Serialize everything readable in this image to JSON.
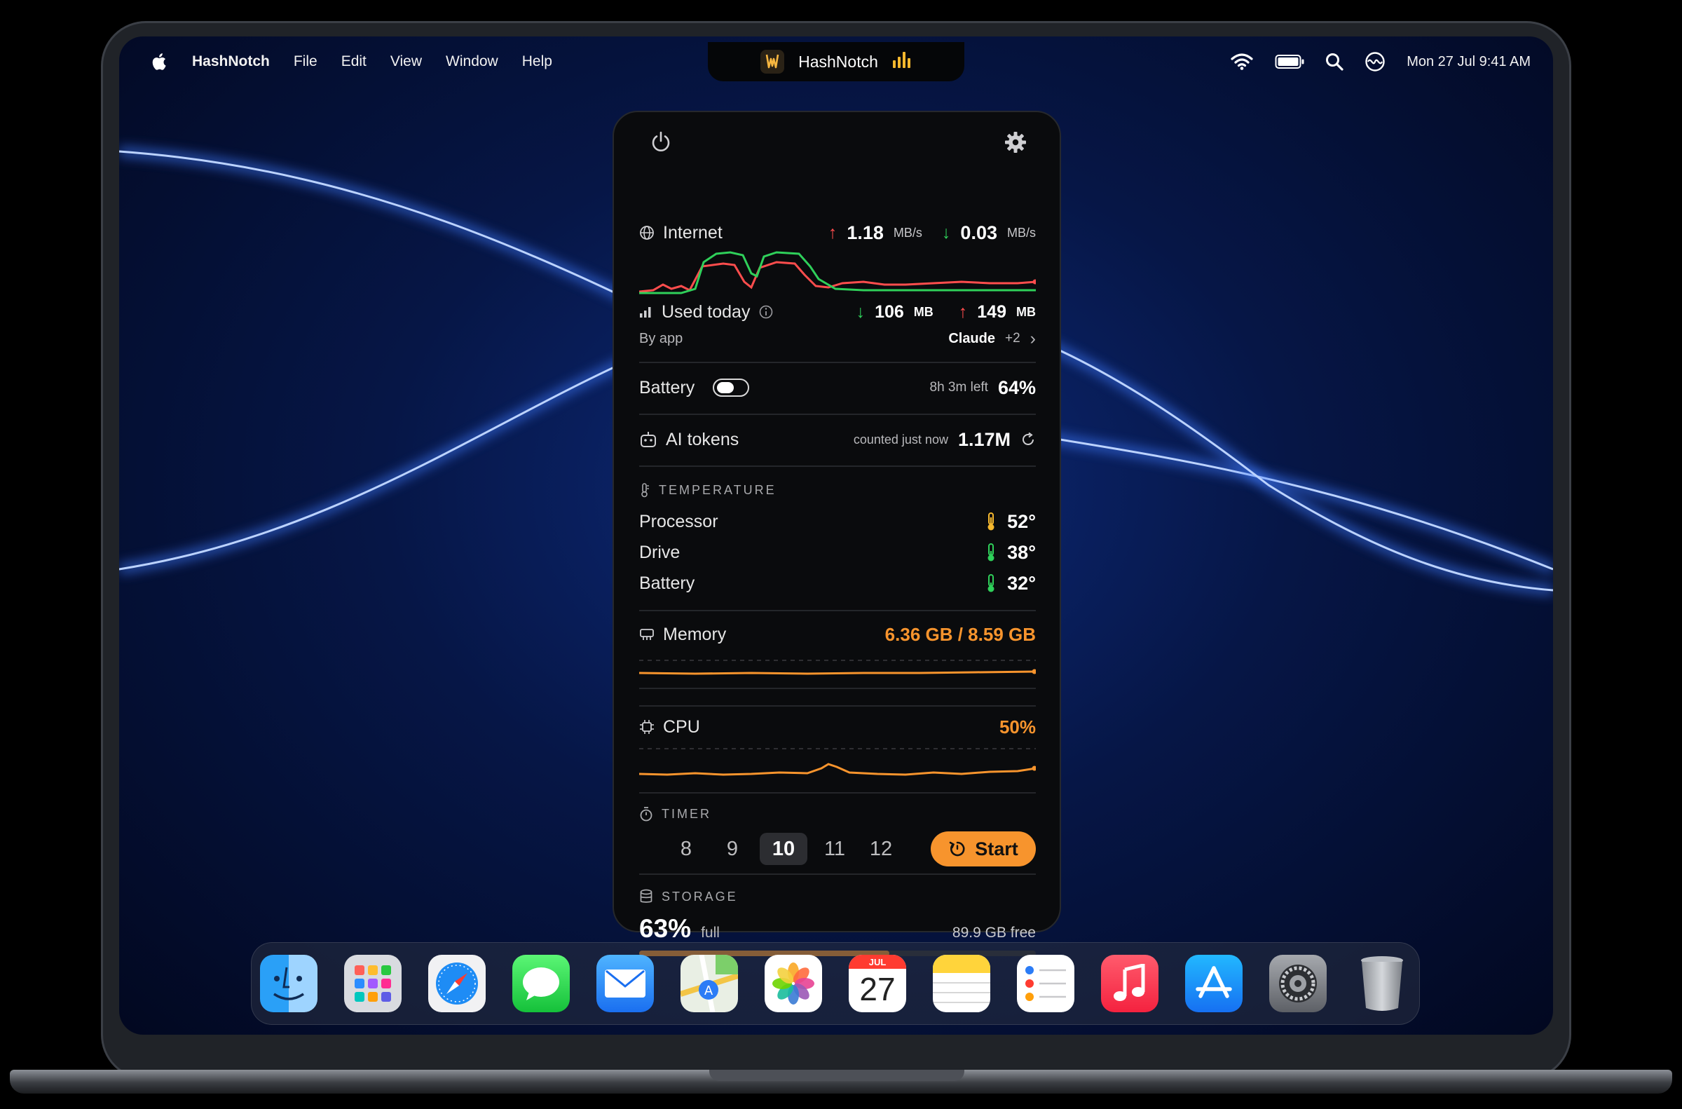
{
  "menubar": {
    "app_name": "HashNotch",
    "menus": [
      "File",
      "Edit",
      "View",
      "Window",
      "Help"
    ],
    "clock": "Mon 27 Jul  9:41 AM"
  },
  "notch": {
    "title": "HashNotch"
  },
  "internet": {
    "label": "Internet",
    "upload_value": "1.18",
    "upload_unit": "MB/s",
    "download_value": "0.03",
    "download_unit": "MB/s",
    "used_today_label": "Used today",
    "used_down_value": "106",
    "used_down_unit": "MB",
    "used_up_value": "149",
    "used_up_unit": "MB",
    "by_app_label": "By app",
    "top_app": "Claude",
    "more_apps": "+2"
  },
  "battery": {
    "label": "Battery",
    "time_left": "8h 3m left",
    "percent": "64%"
  },
  "ai_tokens": {
    "label": "AI tokens",
    "status": "counted just now",
    "value": "1.17M"
  },
  "temperature": {
    "header": "TEMPERATURE",
    "rows": [
      {
        "label": "Processor",
        "value": "52°",
        "color": "#f5b82e"
      },
      {
        "label": "Drive",
        "value": "38°",
        "color": "#2fd05a"
      },
      {
        "label": "Battery",
        "value": "32°",
        "color": "#2fd05a"
      }
    ]
  },
  "memory": {
    "label": "Memory",
    "value": "6.36 GB / 8.59 GB"
  },
  "cpu": {
    "label": "CPU",
    "value": "50%"
  },
  "timer": {
    "header": "TIMER",
    "options": [
      "8",
      "9",
      "10",
      "11",
      "12"
    ],
    "selected": "10",
    "start_label": "Start"
  },
  "storage": {
    "header": "STORAGE",
    "percent": "63%",
    "full_label": "full",
    "free": "89.9 GB free",
    "fill_fraction": 0.63
  },
  "dock": {
    "apps": [
      "finder-icon",
      "launchpad-icon",
      "safari-icon",
      "messages-icon",
      "mail-icon",
      "maps-icon",
      "photos-icon",
      "calendar-icon",
      "notes-icon",
      "reminders-icon",
      "music-icon",
      "app-store-icon",
      "system-settings-icon",
      "trash-icon"
    ],
    "calendar_month": "JUL",
    "calendar_day": "27"
  },
  "colors": {
    "accent_orange": "#f7942d",
    "upload_red": "#ff4d4d",
    "download_green": "#2fd05a",
    "glow_blue": "#3f7bff"
  }
}
